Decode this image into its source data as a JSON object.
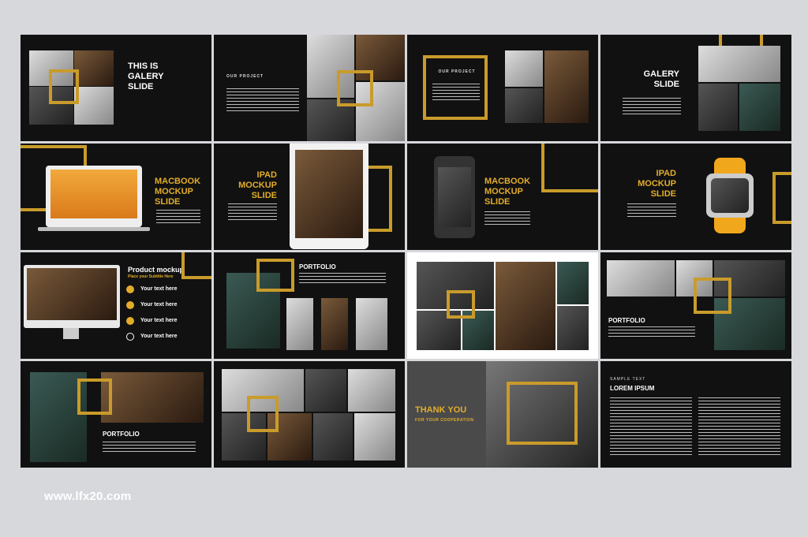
{
  "slides": {
    "s1": {
      "title": "THIS IS GALERY SLIDE"
    },
    "s2": {
      "title": "OUR PROJECT"
    },
    "s3": {
      "title": "OUR PROJECT"
    },
    "s4": {
      "title": "GALERY SLIDE"
    },
    "s5": {
      "title": "MACBOOK MOCKUP SLIDE"
    },
    "s6": {
      "title": "IPAD MOCKUP SLIDE"
    },
    "s7": {
      "title": "MACBOOK MOCKUP SLIDE"
    },
    "s8": {
      "title": "IPAD MOCKUP SLIDE"
    },
    "s9": {
      "title": "Product mockup",
      "subtitle": "Place your Subtitle Here",
      "items": [
        "Your text here",
        "Your text here",
        "Your text here",
        "Your text here"
      ]
    },
    "s10": {
      "title": "PORTFOLIO"
    },
    "s12": {
      "title": "PORTFOLIO"
    },
    "s13": {
      "title": "PORTFOLIO"
    },
    "s15": {
      "title": "THANK YOU",
      "subtitle": "FOR YOUR COOPERATION"
    },
    "s16": {
      "kicker": "SAMPLE TEXT",
      "title": "LOREM IPSUM"
    }
  },
  "watermark": "www.lfx20.com",
  "colors": {
    "accent": "#c99b2b",
    "slide_bg": "#111111",
    "page_bg": "#d7d8dc"
  }
}
